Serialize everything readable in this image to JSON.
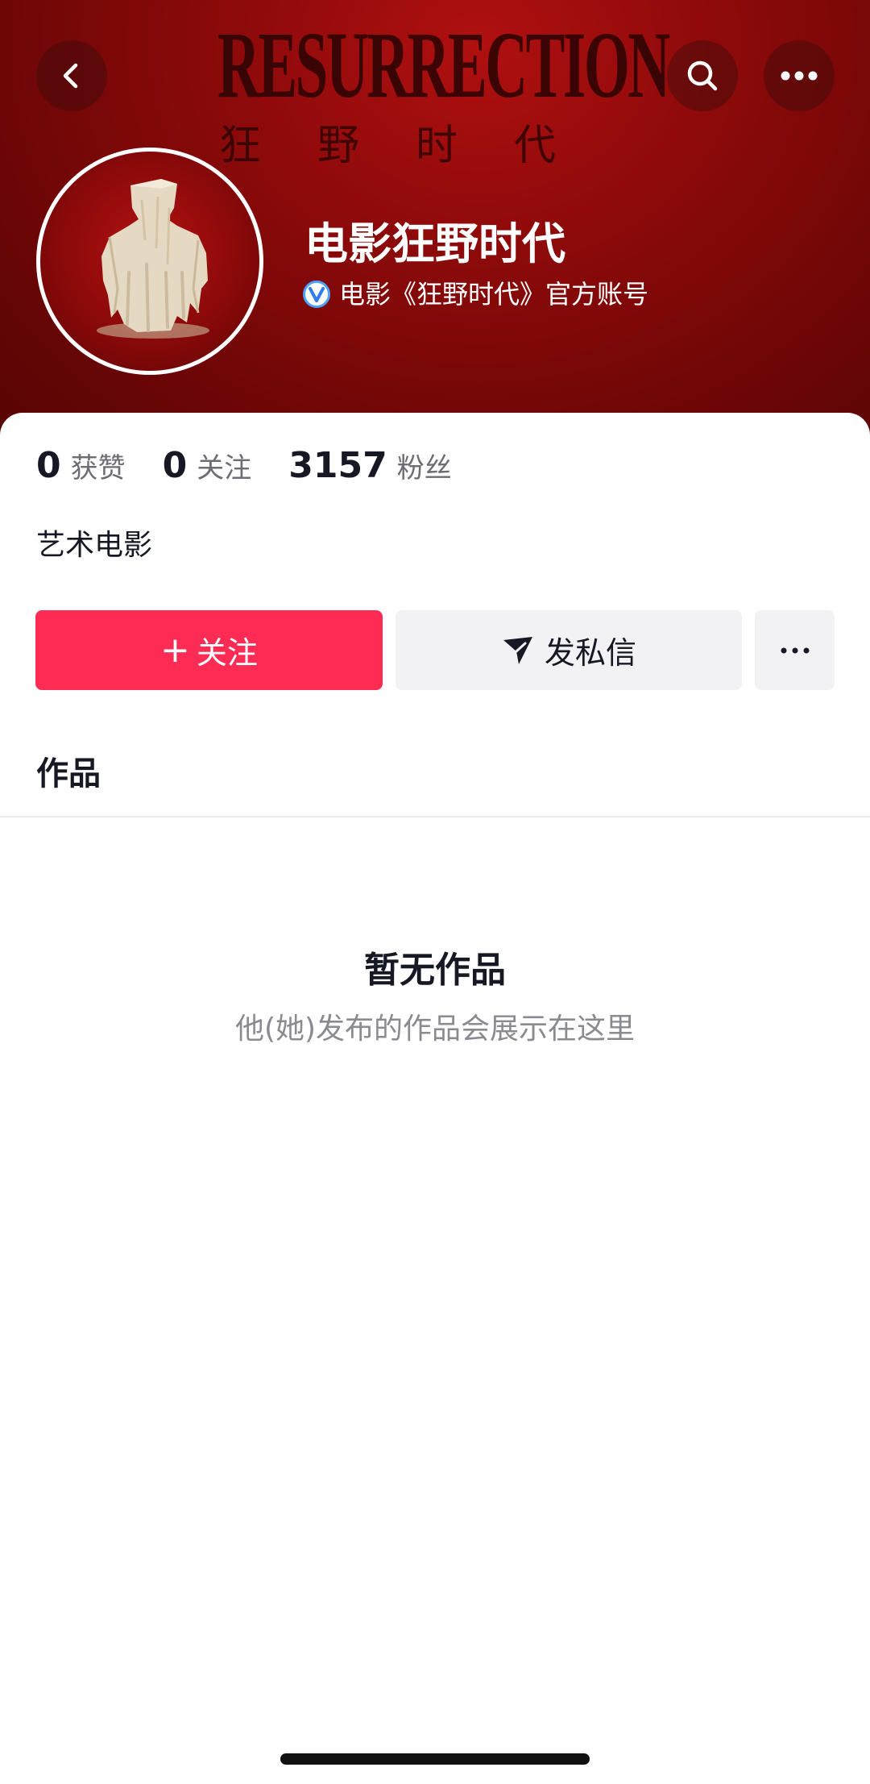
{
  "banner": {
    "title": "RESURRECTION",
    "subtitle": "狂野时代"
  },
  "header": {
    "back_icon": "chevron-left-icon",
    "search_icon": "search-icon",
    "more_icon": "more-dots-icon"
  },
  "profile": {
    "name": "电影狂野时代",
    "verified_label": "电影《狂野时代》官方账号",
    "verify_icon": "verified-v-icon",
    "bio": "艺术电影"
  },
  "stats": [
    {
      "value": "0",
      "label": "获赞"
    },
    {
      "value": "0",
      "label": "关注"
    },
    {
      "value": "3157",
      "label": "粉丝"
    }
  ],
  "actions": {
    "follow_plus": "+",
    "follow_label": "关注",
    "message_label": "发私信",
    "more_label": "···"
  },
  "tabs": {
    "works": "作品"
  },
  "empty_state": {
    "title": "暂无作品",
    "subtitle": "他(她)发布的作品会展示在这里"
  },
  "colors": {
    "accent": "#fe2c55",
    "banner": "#8e0a0a",
    "verify": "#4aa3ff"
  }
}
